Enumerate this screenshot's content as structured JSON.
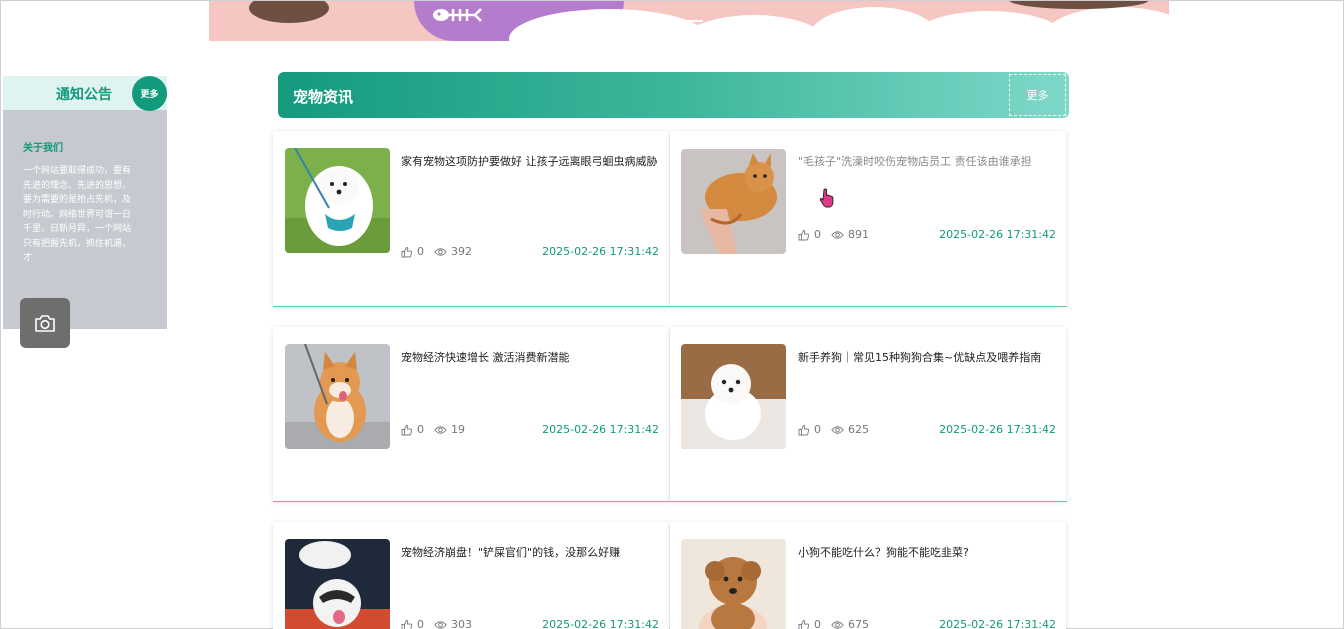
{
  "notice": {
    "title": "通知公告",
    "more_label": "更多",
    "about_title": "关于我们",
    "about_text": "一个网站要取得成功，要有先进的理念、先进的思想，要为需要的是抢占先机，及时行动。网络世界可谓一日千里、日新月异，一个网站只有把握先机，抓住机遇，才"
  },
  "news": {
    "title": "宠物资讯",
    "more_label": "更多",
    "items": [
      {
        "title": "家有宠物这项防护要做好 让孩子远离眼弓蛔虫病威胁",
        "likes": "0",
        "views": "392",
        "date": "2025-02-26 17:31:42"
      },
      {
        "title": "\"毛孩子\"洗澡时咬伤宠物店员工 责任该由谁承担",
        "likes": "0",
        "views": "891",
        "date": "2025-02-26 17:31:42"
      },
      {
        "title": "宠物经济快速增长 激活消费新潜能",
        "likes": "0",
        "views": "19",
        "date": "2025-02-26 17:31:42"
      },
      {
        "title": "新手养狗｜常见15种狗狗合集~优缺点及喂养指南",
        "likes": "0",
        "views": "625",
        "date": "2025-02-26 17:31:42"
      },
      {
        "title": "宠物经济崩盘！\"铲屎官们\"的钱，没那么好赚",
        "likes": "0",
        "views": "303",
        "date": "2025-02-26 17:31:42"
      },
      {
        "title": "小狗不能吃什么？狗能不能吃韭菜?",
        "likes": "0",
        "views": "675",
        "date": "2025-02-26 17:31:42"
      }
    ]
  },
  "colors": {
    "accent": "#119a7b",
    "banner_pink": "#f6c6c2",
    "banner_purple": "#b47ccc"
  }
}
